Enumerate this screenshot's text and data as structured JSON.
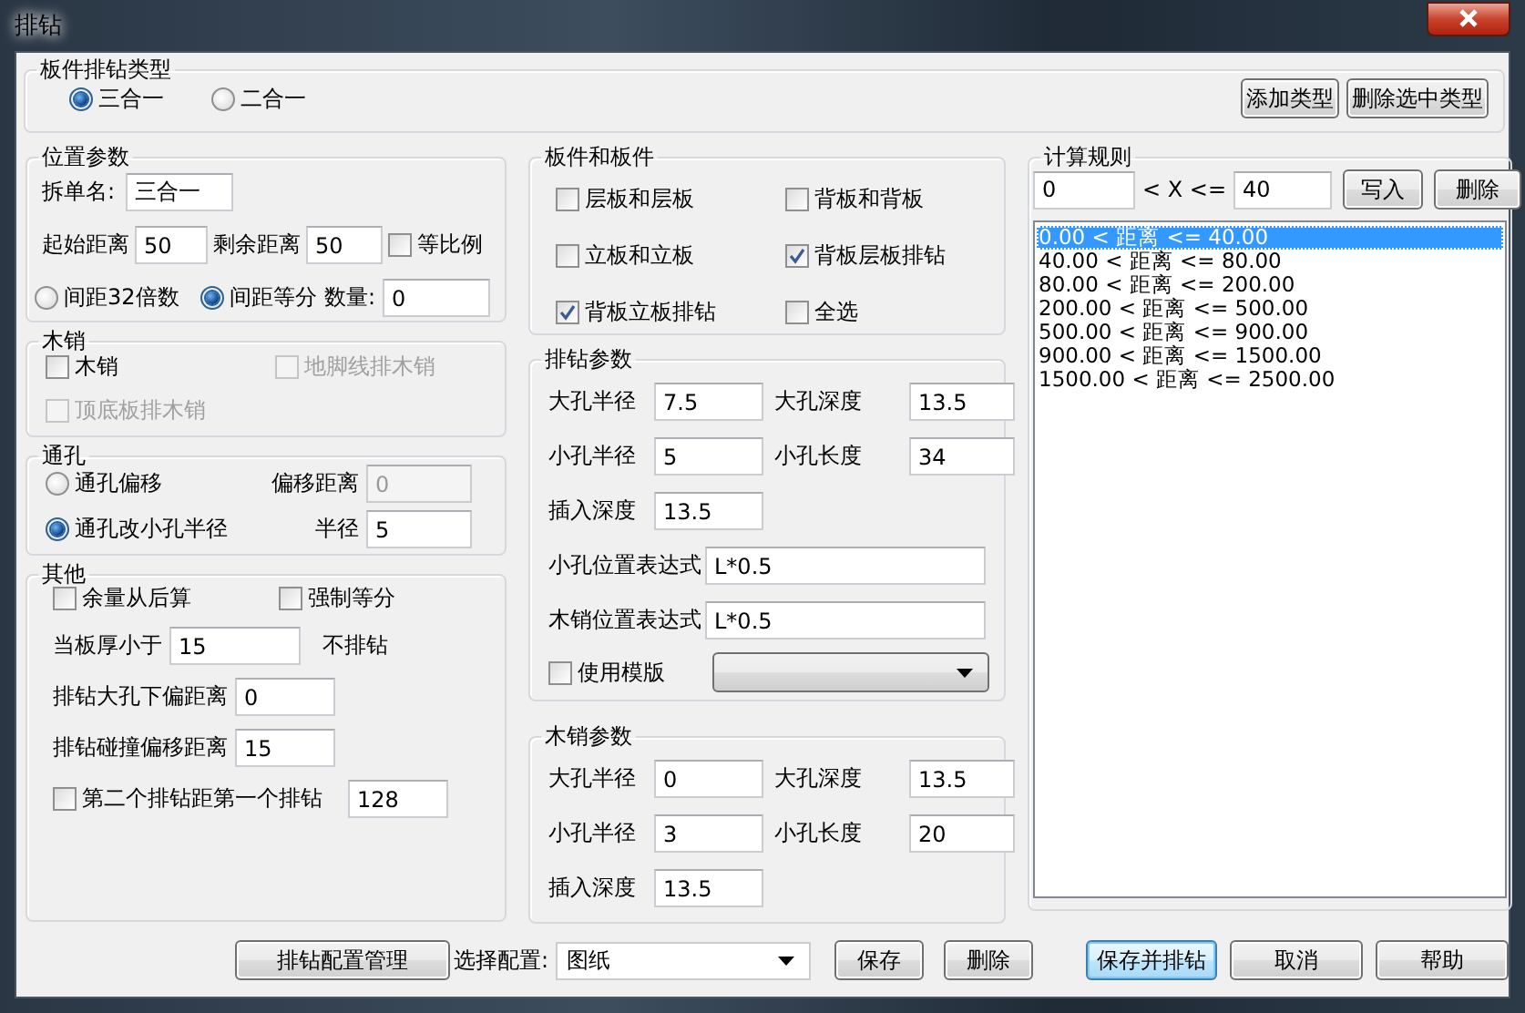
{
  "window": {
    "title": "排钻"
  },
  "type_group": {
    "title": "板件排钻类型",
    "options": [
      {
        "label": "三合一",
        "selected": true
      },
      {
        "label": "二合一",
        "selected": false
      }
    ],
    "buttons": [
      "添加类型",
      "删除选中类型"
    ]
  },
  "position": {
    "title": "位置参数",
    "name": {
      "label": "拆单名:",
      "value": "三合一"
    },
    "start": {
      "label": "起始距离",
      "value": "50"
    },
    "remain": {
      "label": "剩余距离",
      "value": "50"
    },
    "proportional": {
      "label": "等比例",
      "checked": false
    },
    "spacing": [
      {
        "label": "间距32倍数",
        "selected": false
      },
      {
        "label": "间距等分",
        "selected": true
      }
    ],
    "count": {
      "label": "数量:",
      "value": "0"
    }
  },
  "dowel": {
    "title": "木销",
    "options": [
      {
        "label": "木销",
        "checked": false,
        "disabled": false
      },
      {
        "label": "地脚线排木销",
        "checked": false,
        "disabled": true
      },
      {
        "label": "顶底板排木销",
        "checked": false,
        "disabled": true
      }
    ]
  },
  "through_hole": {
    "title": "通孔",
    "options": [
      {
        "label": "通孔偏移",
        "selected": false,
        "field": {
          "label": "偏移距离",
          "value": "0",
          "disabled": true
        }
      },
      {
        "label": "通孔改小孔半径",
        "selected": true,
        "field": {
          "label": "半径",
          "value": "5",
          "disabled": false
        }
      }
    ]
  },
  "other": {
    "title": "其他",
    "checks": [
      {
        "label": "余量从后算",
        "checked": false
      },
      {
        "label": "强制等分",
        "checked": false
      }
    ],
    "min_thickness": {
      "label": "当板厚小于",
      "value": "15",
      "suffix": "不排钻"
    },
    "fields": [
      {
        "label": "排钻大孔下偏距离",
        "value": "0"
      },
      {
        "label": "排钻碰撞偏移距离",
        "value": "15"
      }
    ],
    "second": {
      "label": "第二个排钻距第一个排钻",
      "checked": false,
      "value": "128"
    }
  },
  "boards": {
    "title": "板件和板件",
    "options": [
      {
        "label": "层板和层板",
        "checked": false
      },
      {
        "label": "背板和背板",
        "checked": false
      },
      {
        "label": "立板和立板",
        "checked": false
      },
      {
        "label": "背板层板排钻",
        "checked": true
      },
      {
        "label": "背板立板排钻",
        "checked": true
      },
      {
        "label": "全选",
        "checked": false
      }
    ]
  },
  "drill_params": {
    "title": "排钻参数",
    "fields": [
      {
        "label": "大孔半径",
        "value": "7.5"
      },
      {
        "label": "大孔深度",
        "value": "13.5"
      },
      {
        "label": "小孔半径",
        "value": "5"
      },
      {
        "label": "小孔长度",
        "value": "34"
      },
      {
        "label": "插入深度",
        "value": "13.5"
      }
    ],
    "expressions": [
      {
        "label": "小孔位置表达式",
        "value": "L*0.5"
      },
      {
        "label": "木销位置表达式",
        "value": "L*0.5"
      }
    ],
    "template": {
      "label": "使用模版",
      "checked": false
    }
  },
  "dowel_params": {
    "title": "木销参数",
    "fields": [
      {
        "label": "大孔半径",
        "value": "0"
      },
      {
        "label": "大孔深度",
        "value": "13.5"
      },
      {
        "label": "小孔半径",
        "value": "3"
      },
      {
        "label": "小孔长度",
        "value": "20"
      },
      {
        "label": "插入深度",
        "value": "13.5"
      }
    ]
  },
  "rules": {
    "title": "计算规则",
    "from": "0",
    "operator": "< X <=",
    "to": "40",
    "buttons": [
      "写入",
      "删除"
    ],
    "items": [
      {
        "text": "0.00 < 距离 <= 40.00",
        "selected": true
      },
      {
        "text": "40.00 < 距离 <= 80.00",
        "selected": false
      },
      {
        "text": "80.00 < 距离 <= 200.00",
        "selected": false
      },
      {
        "text": "200.00 < 距离 <= 500.00",
        "selected": false
      },
      {
        "text": "500.00 < 距离 <= 900.00",
        "selected": false
      },
      {
        "text": "900.00 < 距离 <= 1500.00",
        "selected": false
      },
      {
        "text": "1500.00 < 距离 <= 2500.00",
        "selected": false
      }
    ]
  },
  "footer": {
    "manage": "排钻配置管理",
    "config_label": "选择配置:",
    "config_value": "图纸",
    "config_buttons": [
      "保存",
      "删除"
    ],
    "dialog_buttons": [
      {
        "label": "保存并排钻",
        "default": true
      },
      {
        "label": "取消",
        "default": false
      },
      {
        "label": "帮助",
        "default": false
      }
    ]
  }
}
